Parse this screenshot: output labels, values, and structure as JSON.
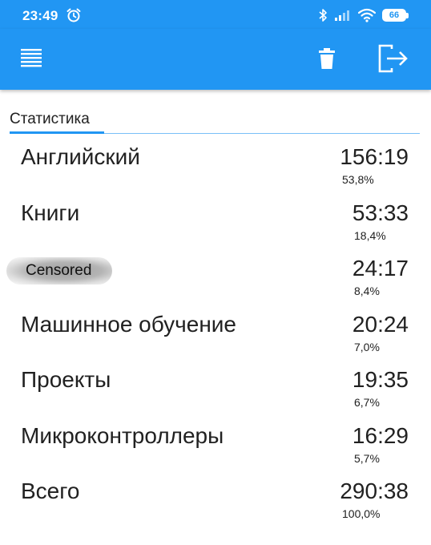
{
  "status_bar": {
    "time": "23:49",
    "battery": "66",
    "icons": [
      "alarm-icon",
      "bluetooth-icon",
      "signal-icon",
      "wifi-icon",
      "battery-icon"
    ]
  },
  "app_bar": {
    "background": "#2196f3",
    "icons": [
      "list-menu-icon",
      "trash-icon",
      "exit-icon"
    ]
  },
  "tab": {
    "label": "Статистика",
    "accent": "#2196f3"
  },
  "stats": [
    {
      "name": "Английский",
      "time": "156:19",
      "percent": "53,8%"
    },
    {
      "name": "Книги",
      "time": "53:33",
      "percent": "18,4%"
    },
    {
      "name": "Censored",
      "time": "24:17",
      "percent": "8,4%"
    },
    {
      "name": "Машинное обучение",
      "time": "20:24",
      "percent": "7,0%"
    },
    {
      "name": "Проекты",
      "time": "19:35",
      "percent": "6,7%"
    },
    {
      "name": "Микроконтроллеры",
      "time": "16:29",
      "percent": "5,7%"
    },
    {
      "name": "Всего",
      "time": "290:38",
      "percent": "100,0%"
    }
  ]
}
